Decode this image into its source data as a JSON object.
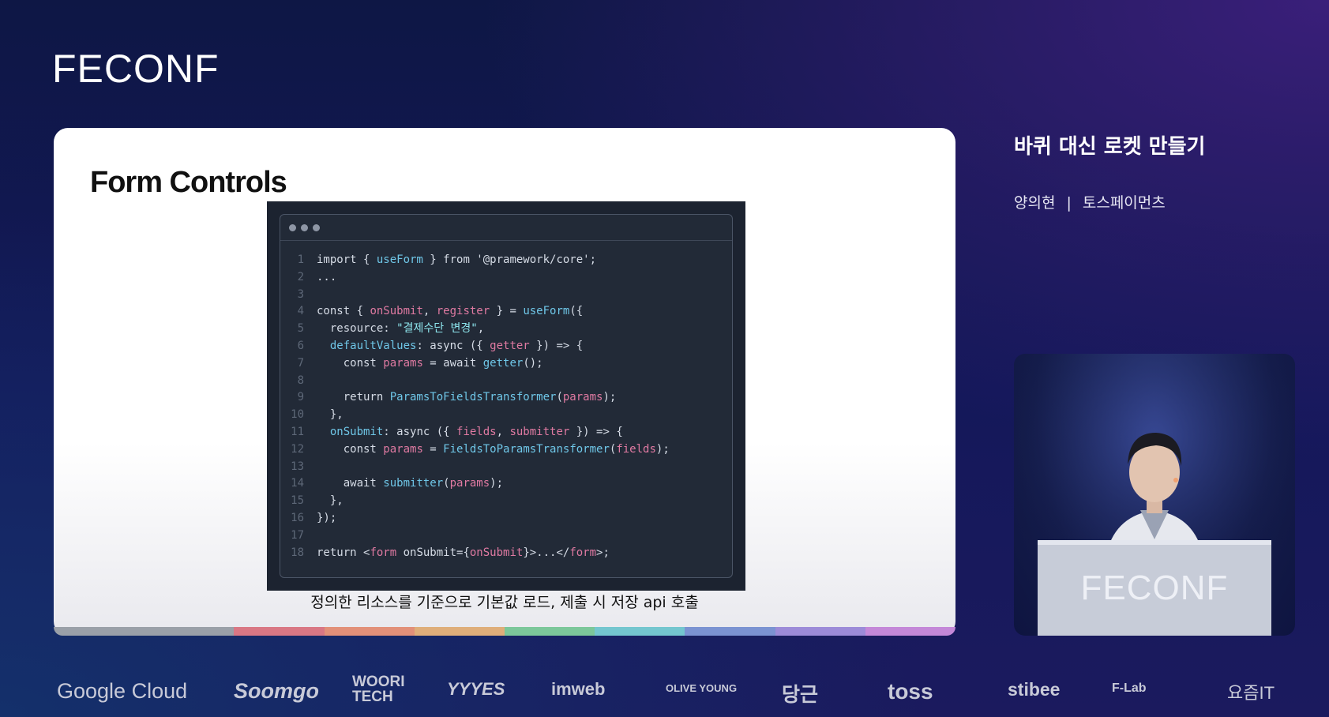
{
  "header": {
    "logo": "FECONF"
  },
  "slide": {
    "title": "Form Controls",
    "code_lines": [
      [
        [
          "import { ",
          "w"
        ],
        [
          "useForm",
          "b"
        ],
        [
          " } from '@pramework/core';",
          "w"
        ]
      ],
      [
        [
          "...",
          "w"
        ]
      ],
      [],
      [
        [
          "const { ",
          "w"
        ],
        [
          "onSubmit",
          "p"
        ],
        [
          ", ",
          "w"
        ],
        [
          "register",
          "p"
        ],
        [
          " } = ",
          "w"
        ],
        [
          "useForm",
          "b"
        ],
        [
          "({",
          "w"
        ]
      ],
      [
        [
          "  resource: ",
          "w"
        ],
        [
          "\"결제수단 변경\"",
          "s"
        ],
        [
          ",",
          "w"
        ]
      ],
      [
        [
          "  ",
          "w"
        ],
        [
          "defaultValues",
          "b"
        ],
        [
          ": async ({ ",
          "w"
        ],
        [
          "getter",
          "p"
        ],
        [
          " }) => {",
          "w"
        ]
      ],
      [
        [
          "    const ",
          "w"
        ],
        [
          "params",
          "p"
        ],
        [
          " = await ",
          "w"
        ],
        [
          "getter",
          "b"
        ],
        [
          "();",
          "w"
        ]
      ],
      [],
      [
        [
          "    return ",
          "w"
        ],
        [
          "ParamsToFieldsTransformer",
          "b"
        ],
        [
          "(",
          "w"
        ],
        [
          "params",
          "p"
        ],
        [
          ");",
          "w"
        ]
      ],
      [
        [
          "  },",
          "w"
        ]
      ],
      [
        [
          "  ",
          "w"
        ],
        [
          "onSubmit",
          "b"
        ],
        [
          ": async ({ ",
          "w"
        ],
        [
          "fields",
          "p"
        ],
        [
          ", ",
          "w"
        ],
        [
          "submitter",
          "p"
        ],
        [
          " }) => {",
          "w"
        ]
      ],
      [
        [
          "    const ",
          "w"
        ],
        [
          "params",
          "p"
        ],
        [
          " = ",
          "w"
        ],
        [
          "FieldsToParamsTransformer",
          "b"
        ],
        [
          "(",
          "w"
        ],
        [
          "fields",
          "p"
        ],
        [
          ");",
          "w"
        ]
      ],
      [],
      [
        [
          "    await ",
          "w"
        ],
        [
          "submitter",
          "b"
        ],
        [
          "(",
          "w"
        ],
        [
          "params",
          "p"
        ],
        [
          ");",
          "w"
        ]
      ],
      [
        [
          "  },",
          "w"
        ]
      ],
      [
        [
          "});",
          "w"
        ]
      ],
      [],
      [
        [
          "return <",
          "w"
        ],
        [
          "form",
          "p"
        ],
        [
          " onSubmit={",
          "w"
        ],
        [
          "onSubmit",
          "p"
        ],
        [
          "}>...</",
          "w"
        ],
        [
          "form",
          "p"
        ],
        [
          ">;",
          "w"
        ]
      ]
    ],
    "caption": "정의한 리소스를 기준으로 기본값 로드, 제출 시 저장 api 호출",
    "strip_colors": [
      "#9aa0a8",
      "#d97784",
      "#e29079",
      "#dfae7a",
      "#7cc79a",
      "#74c6cf",
      "#7b93d2",
      "#9c8bd8",
      "#c488d8"
    ]
  },
  "talk": {
    "title": "바퀴 대신 로켓 만들기",
    "speaker": "양의현",
    "separator": "|",
    "company": "토스페이먼츠"
  },
  "camera": {
    "podium_logo": "FECONF"
  },
  "sponsors": [
    "Google Cloud",
    "Soomgo",
    "WOORI TECH",
    "YYYES",
    "imweb",
    "OLIVE YOUNG",
    "당근",
    "toss",
    "stibee",
    "F-Lab",
    "요즘IT"
  ]
}
